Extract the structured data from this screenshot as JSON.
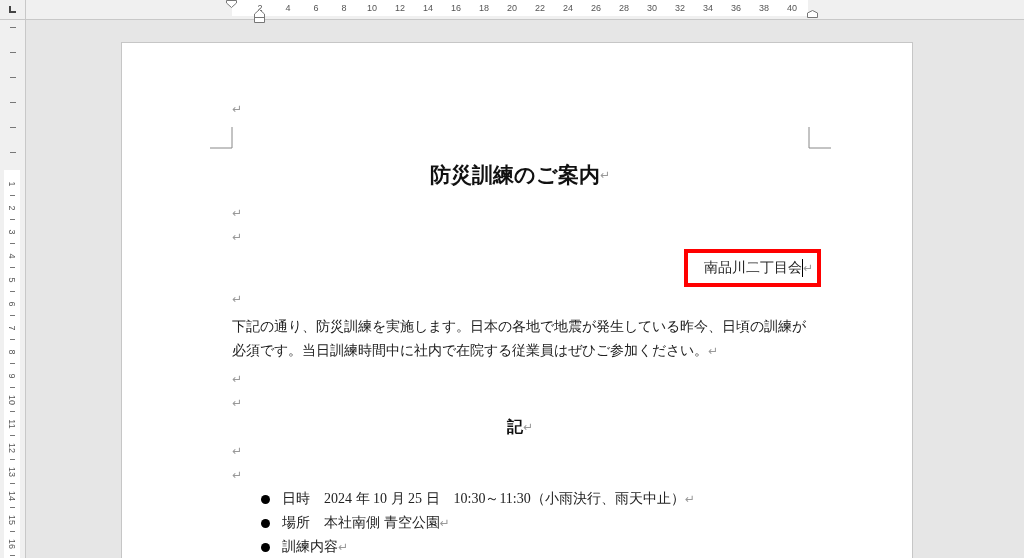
{
  "ruler": {
    "horizontal_labels": [
      "2",
      "4",
      "6",
      "8",
      "10",
      "12",
      "14",
      "16",
      "18",
      "20",
      "22",
      "24",
      "26",
      "28",
      "30",
      "32",
      "34",
      "36",
      "38",
      "40"
    ],
    "vertical_labels": [
      "1",
      "2",
      "3",
      "4",
      "5",
      "6",
      "7",
      "8",
      "9",
      "10",
      "11",
      "12",
      "13",
      "14",
      "15",
      "16"
    ]
  },
  "document": {
    "paragraphs": [
      {
        "kind": "empty",
        "mark": "↵"
      },
      {
        "kind": "corners"
      },
      {
        "kind": "title",
        "text": "防災訓練のご案内",
        "mark": "↵"
      },
      {
        "kind": "empty",
        "mark": "↵"
      },
      {
        "kind": "empty",
        "mark": "↵"
      },
      {
        "kind": "right",
        "text": "南品川二丁目会",
        "mark": "↵",
        "highlighted": true,
        "cursor": true
      },
      {
        "kind": "empty",
        "mark": "↵"
      },
      {
        "kind": "body",
        "text": "下記の通り、防災訓練を実施します。日本の各地で地震が発生している昨今、日頃の訓練が必須です。当日訓練時間中に社内で在院する従業員はぜひご参加ください。",
        "mark": "↵"
      },
      {
        "kind": "empty",
        "mark": "↵"
      },
      {
        "kind": "empty",
        "mark": "↵"
      },
      {
        "kind": "center",
        "text": "記",
        "mark": "↵"
      },
      {
        "kind": "empty",
        "mark": "↵"
      },
      {
        "kind": "empty",
        "mark": "↵"
      },
      {
        "kind": "bullet",
        "text": "日時　2024 年 10 月 25 日　10:30～11:30（小雨決行、雨天中止）",
        "mark": "↵"
      },
      {
        "kind": "bullet",
        "text": "場所　本社南側 青空公園",
        "mark": "↵"
      },
      {
        "kind": "bullet",
        "text": "訓練内容",
        "mark": "↵"
      }
    ]
  }
}
